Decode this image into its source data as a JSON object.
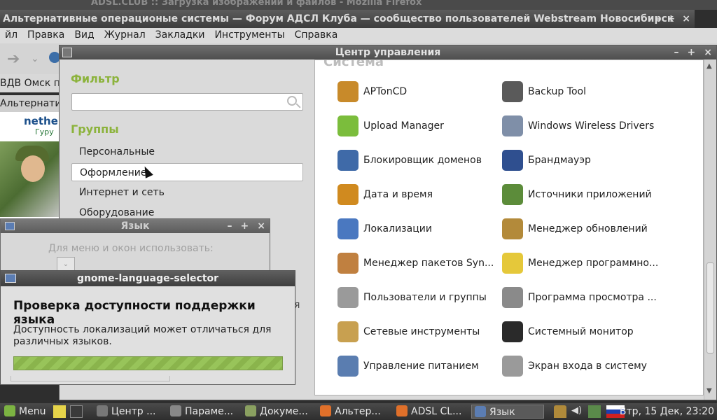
{
  "firefox": {
    "tab_title": "ADSL.CLUB :: Загрузка изображений и файлов - Mozilla Firefox",
    "title": "Альтернативные операционые системы — Форум АДСЛ Клуба — сообщество пользователей Webstream Новосибирск",
    "window_buttons": [
      "–",
      "+",
      "×"
    ],
    "menu": [
      "йл",
      "Правка",
      "Вид",
      "Журнал",
      "Закладки",
      "Инструменты",
      "Справка"
    ],
    "bookmark_partial": "ВДВ Омск п О",
    "tab_partial": "Альтернатив",
    "post": {
      "nick": "nethel",
      "rank": "Гуру"
    }
  },
  "control_center": {
    "title": "Центр управления",
    "filter_heading": "Фильтр",
    "search_placeholder": "",
    "groups_heading": "Группы",
    "groups": [
      "Персональные",
      "Оформление",
      "Интернет и сеть",
      "Оборудование"
    ],
    "selected_group": "Оформление",
    "section_title": "Система",
    "items": [
      {
        "label": "APTonCD",
        "icon": "aptoncd-icon",
        "color": "#c88a2a"
      },
      {
        "label": "Backup Tool",
        "icon": "backup-tool-icon",
        "color": "#5a5a5a"
      },
      {
        "label": "Upload Manager",
        "icon": "upload-manager-icon",
        "color": "#7bbd3c"
      },
      {
        "label": "Windows Wireless Drivers",
        "icon": "wireless-drivers-icon",
        "color": "#7f8fa8"
      },
      {
        "label": "Блокировщик доменов",
        "icon": "domain-blocker-icon",
        "color": "#3f6aa8"
      },
      {
        "label": "Брандмауэр",
        "icon": "firewall-icon",
        "color": "#2f4f8f"
      },
      {
        "label": "Дата и время",
        "icon": "date-time-icon",
        "color": "#d08a1f"
      },
      {
        "label": "Источники приложений",
        "icon": "software-sources-icon",
        "color": "#5c8c3a"
      },
      {
        "label": "Локализации",
        "icon": "localization-icon",
        "color": "#4a78c0"
      },
      {
        "label": "Менеджер обновлений",
        "icon": "update-manager-icon",
        "color": "#b38a3a"
      },
      {
        "label": "Менеджер пакетов Syn...",
        "icon": "synaptic-icon",
        "color": "#c08040"
      },
      {
        "label": "Менеджер программно...",
        "icon": "software-manager-icon",
        "color": "#e5c83a"
      },
      {
        "label": "Пользователи и группы",
        "icon": "users-groups-icon",
        "color": "#9a9a9a"
      },
      {
        "label": "Программа просмотра ...",
        "icon": "log-viewer-icon",
        "color": "#8a8a8a"
      },
      {
        "label": "Сетевые инструменты",
        "icon": "network-tools-icon",
        "color": "#c8a050"
      },
      {
        "label": "Системный монитор",
        "icon": "system-monitor-icon",
        "color": "#2a2a2a"
      },
      {
        "label": "Управление питанием",
        "icon": "power-management-icon",
        "color": "#5a7db0"
      },
      {
        "label": "Экран входа в систему",
        "icon": "login-screen-icon",
        "color": "#9a9a9a"
      }
    ]
  },
  "language_window": {
    "title": "Язык",
    "prompt": "Для меню и окон использовать:",
    "partial_text": "я"
  },
  "language_selector": {
    "title": "gnome-language-selector",
    "heading": "Проверка доступности поддержки языка",
    "message": "Доступность локализаций может отличаться для различных языков.",
    "progress": 1.0
  },
  "taskbar": {
    "menu_label": "Menu",
    "items": [
      {
        "label": "Центр ...",
        "icon": "control-center-icon",
        "color": "#777"
      },
      {
        "label": "Параме...",
        "icon": "settings-icon",
        "color": "#888"
      },
      {
        "label": "Докуме...",
        "icon": "document-icon",
        "color": "#8aa060"
      },
      {
        "label": "Альтер...",
        "icon": "firefox-icon",
        "color": "#e0702a"
      },
      {
        "label": "ADSL CL...",
        "icon": "firefox-icon",
        "color": "#e0702a"
      },
      {
        "label": "Язык",
        "icon": "language-icon",
        "color": "#5b7db3"
      }
    ],
    "clock": "Втр, 15 Дек, 23:20"
  }
}
